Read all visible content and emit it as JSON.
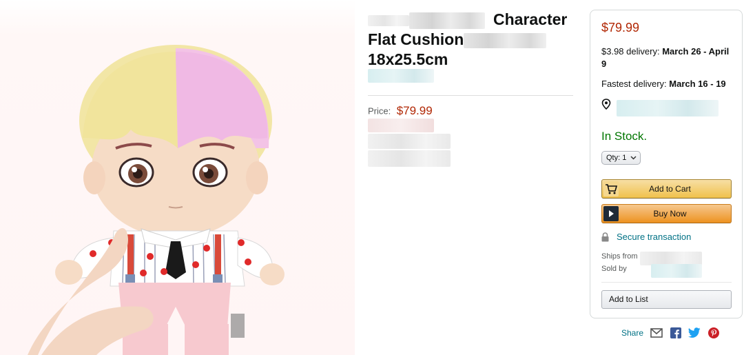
{
  "title": {
    "line1_text": "Character",
    "line2_text": "Flat Cushion",
    "line3_text": "18x25.5cm"
  },
  "price_block": {
    "label": "Price:",
    "value": "$79.99"
  },
  "buy_box": {
    "price": "$79.99",
    "delivery_prefix": "$3.98 delivery:",
    "delivery_dates": "March 26 - April 9",
    "fastest_prefix": "Fastest delivery:",
    "fastest_dates": "March 16 - 19",
    "location_icon": "location-pin-icon",
    "stock": "In Stock.",
    "qty_label": "Qty:",
    "qty_value": "1",
    "add_to_cart": "Add to Cart",
    "buy_now": "Buy Now",
    "secure": "Secure transaction",
    "ships_from": "Ships from",
    "sold_by": "Sold by",
    "add_to_list": "Add to List"
  },
  "share": {
    "label": "Share",
    "icons": [
      "email-icon",
      "facebook-icon",
      "twitter-icon",
      "pinterest-icon"
    ]
  },
  "colors": {
    "price": "#b12704",
    "in_stock": "#007600",
    "link": "#007185",
    "add_to_cart_button": "#f0c14b",
    "buy_now_button": "#ed9220"
  }
}
